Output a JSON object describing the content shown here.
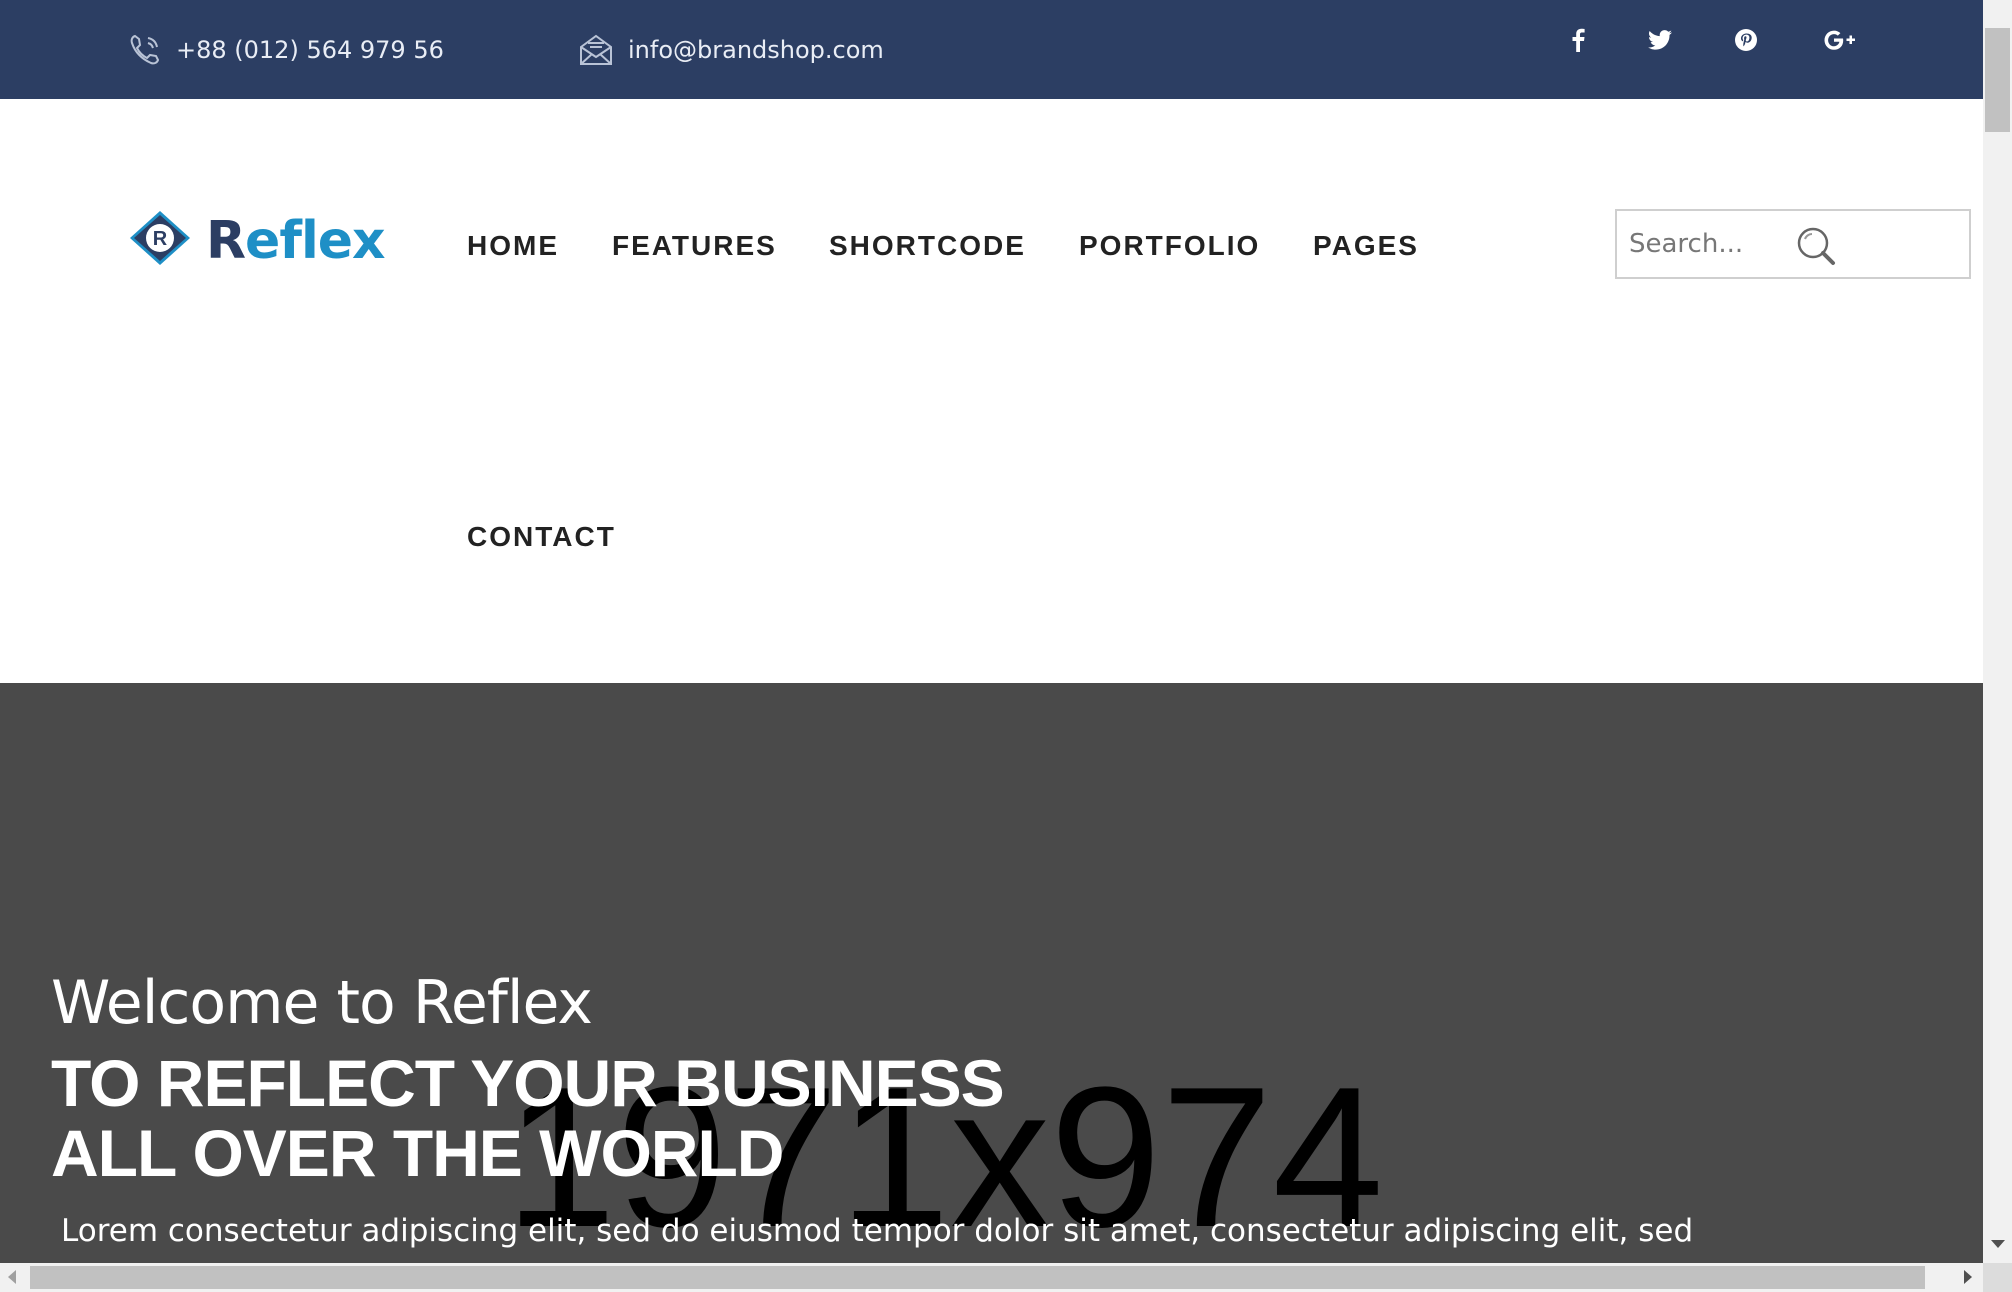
{
  "topbar": {
    "phone": "+88 (012) 564 979 56",
    "email": "info@brandshop.com",
    "phone_icon": "phone-icon",
    "email_icon": "envelope-icon",
    "social": [
      {
        "name": "facebook-icon",
        "glyph": "f"
      },
      {
        "name": "twitter-icon",
        "glyph": "t"
      },
      {
        "name": "pinterest-icon",
        "glyph": "p"
      },
      {
        "name": "google-plus-icon",
        "glyph": "G+"
      }
    ],
    "bg_color": "#2c3e63"
  },
  "logo": {
    "initial": "R",
    "text_r": "R",
    "text_rest": "eflex",
    "colors": {
      "dark": "#2c3e63",
      "accent": "#1e8fc6"
    }
  },
  "nav": {
    "items": [
      "HOME",
      "FEATURES",
      "SHORTCODE",
      "PORTFOLIO",
      "PAGES",
      "CONTACT"
    ]
  },
  "search": {
    "placeholder": "Search...",
    "icon": "search-icon"
  },
  "hero": {
    "welcome": "Welcome to Reflex",
    "headline_line1": "TO REFLECT YOUR BUSINESS",
    "headline_line2": "ALL OVER THE WORLD",
    "body": "Lorem consectetur adipiscing elit, sed do eiusmod tempor dolor sit amet, consectetur adipiscing elit, sed",
    "image_placeholder": "1971x974",
    "bg_color": "#4a4a4a"
  }
}
